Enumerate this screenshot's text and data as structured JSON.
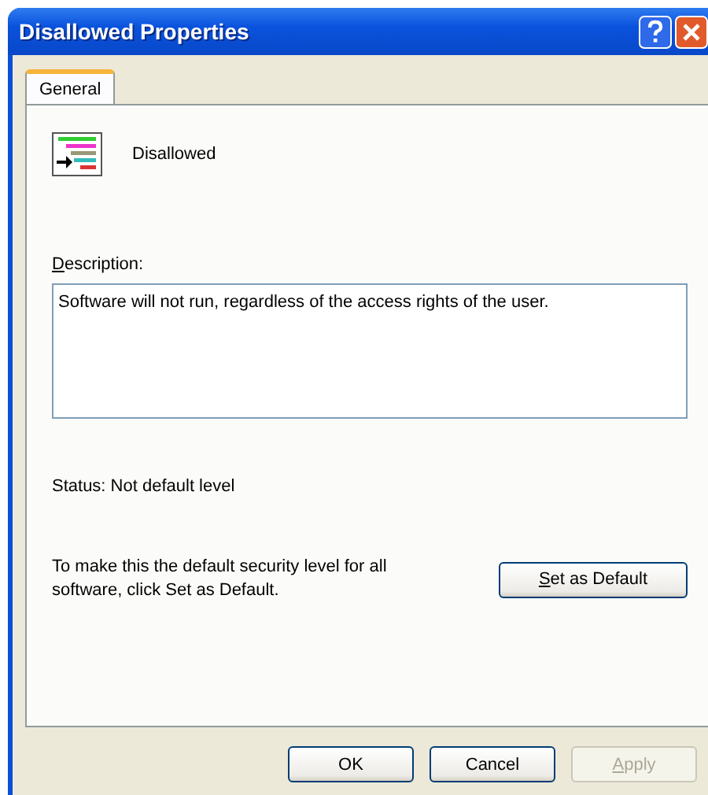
{
  "window": {
    "title": "Disallowed Properties"
  },
  "tabs": [
    {
      "label": "General",
      "selected": true
    }
  ],
  "rule": {
    "name": "Disallowed"
  },
  "description": {
    "label_key": "D",
    "label_rest": "escription:",
    "text": "Software will not run, regardless of the access rights of the user."
  },
  "status": "Status:  Not default level",
  "default_hint": "To make this the default security level for all software, click Set as Default.",
  "set_default_button": {
    "key": "S",
    "rest": "et as Default"
  },
  "buttons": [
    {
      "rest": "OK",
      "disabled": false
    },
    {
      "rest": "Cancel",
      "disabled": false
    },
    {
      "key": "A",
      "rest": "pply",
      "disabled": true
    }
  ]
}
